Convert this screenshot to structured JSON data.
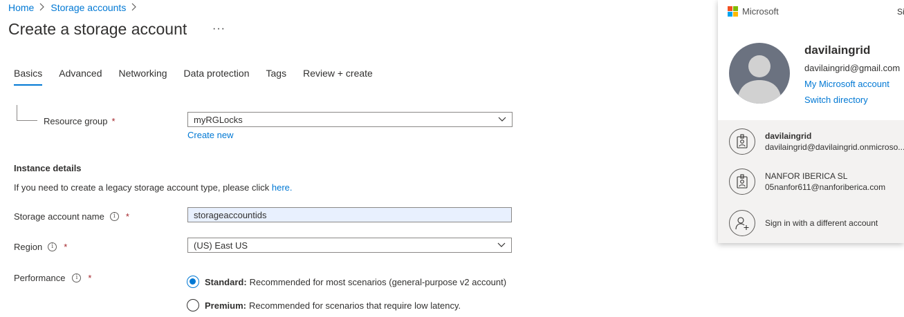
{
  "breadcrumb": {
    "home": "Home",
    "storage_accounts": "Storage accounts",
    "sep": ">"
  },
  "page": {
    "title": "Create a storage account",
    "more": "···"
  },
  "tabs": [
    {
      "label": "Basics",
      "active": true
    },
    {
      "label": "Advanced"
    },
    {
      "label": "Networking"
    },
    {
      "label": "Data protection"
    },
    {
      "label": "Tags"
    },
    {
      "label": "Review + create"
    }
  ],
  "resource_group": {
    "label": "Resource group",
    "required": "*",
    "value": "myRGLocks",
    "create_new": "Create new"
  },
  "instance_details": {
    "title": "Instance details",
    "note": "If you need to create a legacy storage account type, please click ",
    "note_link": "here."
  },
  "storage_name": {
    "label": "Storage account name",
    "required": "*",
    "value": "storageaccountids"
  },
  "region": {
    "label": "Region",
    "required": "*",
    "value": "(US) East US"
  },
  "performance": {
    "label": "Performance",
    "required": "*",
    "options": [
      {
        "bold": "Standard:",
        "text": "Recommended for most scenarios (general-purpose v2 account)",
        "checked": true
      },
      {
        "bold": "Premium:",
        "text": "Recommended for scenarios that require low latency.",
        "checked": false
      }
    ]
  },
  "account_panel": {
    "brand": "Microsoft",
    "sign_out_cut": "Si",
    "name": "davilaingrid",
    "email": "davilaingrid@gmail.com",
    "my_account": "My Microsoft account",
    "switch_directory": "Switch directory",
    "others": [
      {
        "line1": "davilaingrid",
        "line2": "davilaingrid@davilaingrid.onmicroso...",
        "bold": true
      },
      {
        "line1": "NANFOR IBERICA SL",
        "line2": "05nanfor611@nanforiberica.com",
        "bold": false
      }
    ],
    "different_account": "Sign in with a different account"
  },
  "colors": {
    "accent": "#0078d4",
    "required": "#a4262c",
    "input_autofill": "#e8f0fe",
    "panel_bottom": "#f3f2f1"
  },
  "icons": [
    "chevron-right-icon",
    "more-icon",
    "info-icon",
    "chevron-down-icon",
    "microsoft-logo",
    "avatar-icon",
    "badge-icon",
    "add-person-icon"
  ]
}
